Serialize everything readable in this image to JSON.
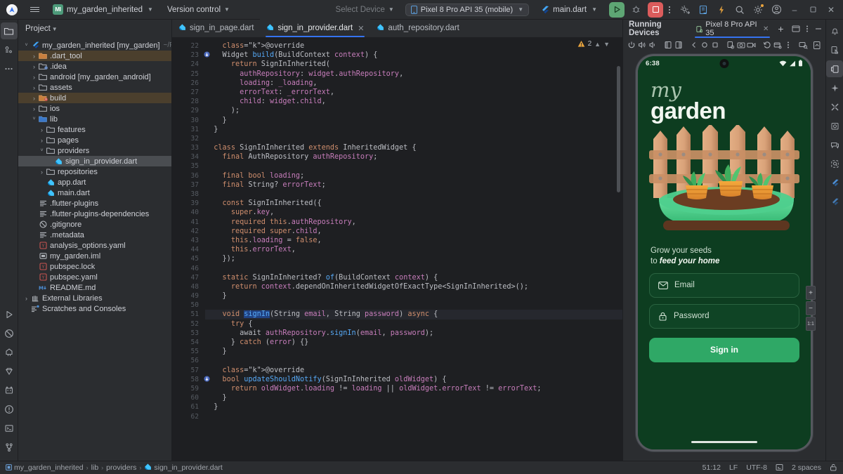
{
  "topbar": {
    "project_name": "my_garden_inherited",
    "project_badge": "MI",
    "version_control": "Version control",
    "select_device": "Select Device",
    "run_config": "Pixel 8 Pro API 35 (mobile)",
    "run_target": "main.dart",
    "icons": [
      "settings-sync-icon",
      "notebook-icon",
      "flash-icon",
      "search-icon",
      "gear-icon",
      "account-icon"
    ],
    "window_min": "–",
    "window_max": "□",
    "window_close": "✕"
  },
  "project_panel": {
    "title": "Project",
    "tree": [
      {
        "depth": 0,
        "arrow": "˅",
        "icon": "flutter",
        "label": "my_garden_inherited [my_garden]",
        "suffix": "~/FlutterProje",
        "state": "normal"
      },
      {
        "depth": 1,
        "arrow": "›",
        "icon": "folder-orange",
        "label": ".dart_tool",
        "suffix": "",
        "state": "hl"
      },
      {
        "depth": 1,
        "arrow": "›",
        "icon": "folder-excl",
        "label": ".idea",
        "suffix": "",
        "state": "normal"
      },
      {
        "depth": 1,
        "arrow": "›",
        "icon": "folder",
        "label": "android [my_garden_android]",
        "suffix": "",
        "state": "normal"
      },
      {
        "depth": 1,
        "arrow": "›",
        "icon": "folder",
        "label": "assets",
        "suffix": "",
        "state": "normal"
      },
      {
        "depth": 1,
        "arrow": "›",
        "icon": "folder-orange-excl",
        "label": "build",
        "suffix": "",
        "state": "hl"
      },
      {
        "depth": 1,
        "arrow": "›",
        "icon": "folder",
        "label": "ios",
        "suffix": "",
        "state": "normal"
      },
      {
        "depth": 1,
        "arrow": "˅",
        "icon": "folder-blue",
        "label": "lib",
        "suffix": "",
        "state": "normal"
      },
      {
        "depth": 2,
        "arrow": "›",
        "icon": "folder",
        "label": "features",
        "suffix": "",
        "state": "normal"
      },
      {
        "depth": 2,
        "arrow": "›",
        "icon": "folder",
        "label": "pages",
        "suffix": "",
        "state": "normal"
      },
      {
        "depth": 2,
        "arrow": "˅",
        "icon": "folder",
        "label": "providers",
        "suffix": "",
        "state": "normal"
      },
      {
        "depth": 3,
        "arrow": "",
        "icon": "dart",
        "label": "sign_in_provider.dart",
        "suffix": "",
        "state": "sel"
      },
      {
        "depth": 2,
        "arrow": "›",
        "icon": "folder",
        "label": "repositories",
        "suffix": "",
        "state": "normal"
      },
      {
        "depth": 2,
        "arrow": "",
        "icon": "dart",
        "label": "app.dart",
        "suffix": "",
        "state": "normal"
      },
      {
        "depth": 2,
        "arrow": "",
        "icon": "dart",
        "label": "main.dart",
        "suffix": "",
        "state": "normal"
      },
      {
        "depth": 1,
        "arrow": "",
        "icon": "text",
        "label": ".flutter-plugins",
        "suffix": "",
        "state": "normal"
      },
      {
        "depth": 1,
        "arrow": "",
        "icon": "text",
        "label": ".flutter-plugins-dependencies",
        "suffix": "",
        "state": "normal"
      },
      {
        "depth": 1,
        "arrow": "",
        "icon": "gitignore",
        "label": ".gitignore",
        "suffix": "",
        "state": "normal"
      },
      {
        "depth": 1,
        "arrow": "",
        "icon": "text",
        "label": ".metadata",
        "suffix": "",
        "state": "normal"
      },
      {
        "depth": 1,
        "arrow": "",
        "icon": "yaml",
        "label": "analysis_options.yaml",
        "suffix": "",
        "state": "normal"
      },
      {
        "depth": 1,
        "arrow": "",
        "icon": "iml",
        "label": "my_garden.iml",
        "suffix": "",
        "state": "normal"
      },
      {
        "depth": 1,
        "arrow": "",
        "icon": "yaml",
        "label": "pubspec.lock",
        "suffix": "",
        "state": "normal"
      },
      {
        "depth": 1,
        "arrow": "",
        "icon": "yaml",
        "label": "pubspec.yaml",
        "suffix": "",
        "state": "normal"
      },
      {
        "depth": 1,
        "arrow": "",
        "icon": "md",
        "label": "README.md",
        "suffix": "",
        "state": "normal"
      },
      {
        "depth": 0,
        "arrow": "›",
        "icon": "library",
        "label": "External Libraries",
        "suffix": "",
        "state": "normal"
      },
      {
        "depth": 0,
        "arrow": "",
        "icon": "scratch",
        "label": "Scratches and Consoles",
        "suffix": "",
        "state": "normal"
      }
    ]
  },
  "editor": {
    "tabs": [
      {
        "label": "sign_in_page.dart",
        "active": false,
        "closable": false
      },
      {
        "label": "sign_in_provider.dart",
        "active": true,
        "closable": true
      },
      {
        "label": "auth_repository.dart",
        "active": false,
        "closable": false
      }
    ],
    "warning_count": "2",
    "first_line_number": 22,
    "current_line": 51,
    "lines": [
      "    @override",
      "    Widget build(BuildContext context) {",
      "      return SignInInherited(",
      "        authRepository: widget.authRepository,",
      "        loading: _loading,",
      "        errorText: _errorText,",
      "        child: widget.child,",
      "      );",
      "    }",
      "  }",
      "",
      "  class SignInInherited extends InheritedWidget {",
      "    final AuthRepository authRepository;",
      "",
      "    final bool loading;",
      "    final String? errorText;",
      "",
      "    const SignInInherited({",
      "      super.key,",
      "      required this.authRepository,",
      "      required super.child,",
      "      this.loading = false,",
      "      this.errorText,",
      "    });",
      "",
      "    static SignInInherited? of(BuildContext context) {",
      "      return context.dependOnInheritedWidgetOfExactType<SignInInherited>();",
      "    }",
      "",
      "    void signIn(String email, String password) async {",
      "      try {",
      "        await authRepository.signIn(email, password);",
      "      } catch (error) {}",
      "    }",
      "",
      "    @override",
      "    bool updateShouldNotify(SignInInherited oldWidget) {",
      "      return oldWidget.loading != loading || oldWidget.errorText != errorText;",
      "    }",
      "  }",
      ""
    ]
  },
  "device_panel": {
    "title": "Running Devices",
    "tab_label": "Pixel 8 Pro API 35",
    "add_tab": "+",
    "toolbar_icons": [
      "power-icon",
      "volume-up-icon",
      "volume-down-icon",
      "rotate-left-icon",
      "rotate-right-icon",
      "back-icon",
      "home-icon",
      "overview-icon",
      "screenshot-file-icon",
      "camera-icon",
      "video-icon",
      "history-icon",
      "folder-device-icon",
      "more-icon",
      "inspect-icon"
    ],
    "zoom_label": "1:1"
  },
  "phone": {
    "status_time": "6:38",
    "wifi_icon": "wifi-icon",
    "signal_icon": "signal-icon",
    "battery_icon": "battery-icon",
    "brand_top": "my",
    "brand_bottom": "garden",
    "tagline_line1": "Grow your seeds",
    "tagline_line2_prefix": "to ",
    "tagline_line2_em": "feed your home",
    "email_placeholder": "Email",
    "password_placeholder": "Password",
    "signin_label": "Sign in",
    "colors": {
      "bg": "#0d3d20",
      "accent": "#2fa866",
      "field_border": "#2a6340"
    }
  },
  "statusbar": {
    "breadcrumb": [
      "my_garden_inherited",
      "lib",
      "providers",
      "sign_in_provider.dart"
    ],
    "caret": "51:12",
    "line_sep": "LF",
    "encoding": "UTF-8",
    "indent": "2 spaces"
  },
  "left_rail": {
    "top": [
      "project-icon",
      "commit-icon",
      "more-icon"
    ],
    "bottom": [
      "run-icon",
      "debug-blocked-icon",
      "flutter-inspector-icon",
      "diamond-icon",
      "cat-icon",
      "problems-icon",
      "terminal-icon",
      "branch-icon"
    ]
  },
  "right_rail": {
    "icons": [
      "notifications-icon",
      "device-manager-icon",
      "running-devices-icon",
      "ai-assistant-icon",
      "tools-icon",
      "gradle-icon",
      "chat-icon",
      "profiler-icon",
      "flutter-outline-icon",
      "flutter-perf-icon"
    ]
  }
}
